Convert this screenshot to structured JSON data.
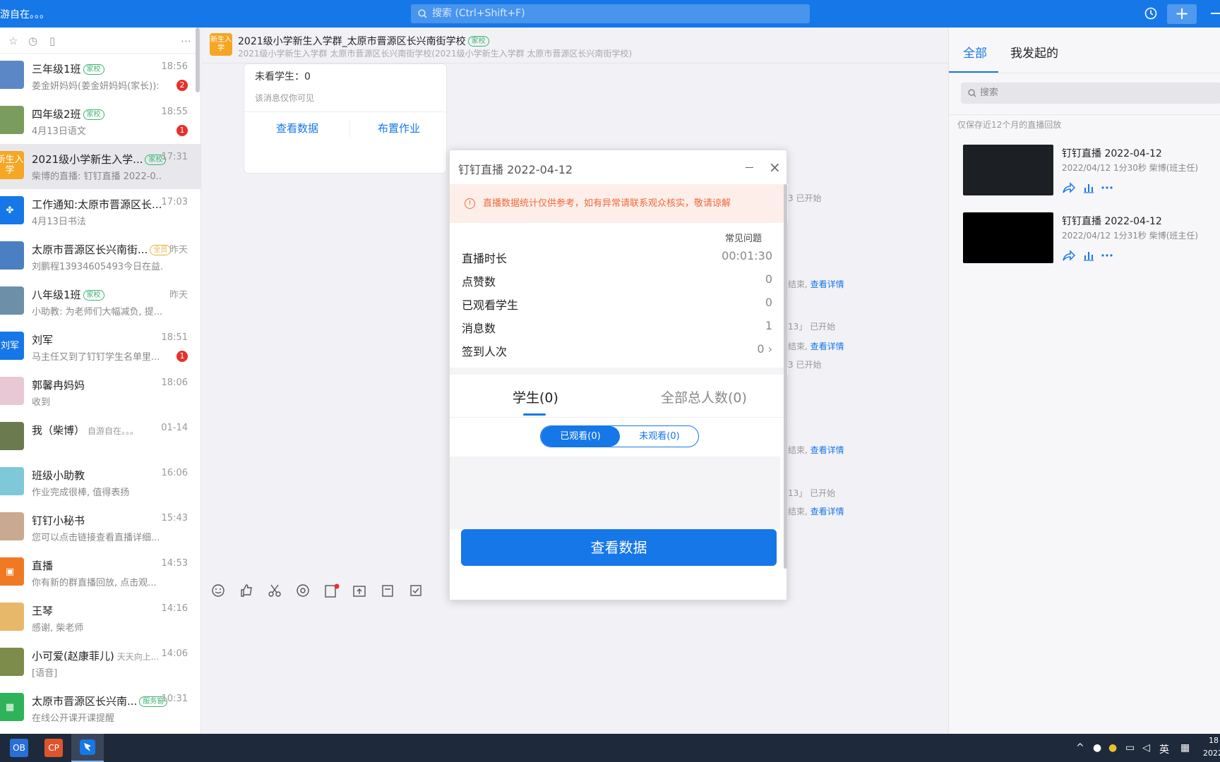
{
  "topbar": {
    "status_text": "游自在。。。",
    "search_placeholder": "搜索 (Ctrl+Shift+F)"
  },
  "conversations": [
    {
      "name": "三年级1班",
      "tag": "家校",
      "time": "18:56",
      "preview": "姜金妍妈妈(姜金妍妈妈(家长)): ...",
      "badge": "2",
      "avatar_color": "#5b87c7",
      "avatar_text": ""
    },
    {
      "name": "四年级2班",
      "tag": "家校",
      "time": "18:55",
      "preview": "4月13日语文",
      "badge": "1",
      "avatar_color": "#7a9c5d",
      "avatar_text": ""
    },
    {
      "name": "2021级小学新生入学...",
      "tag": "家校",
      "time": "17:31",
      "preview": "柴博的直播: 钉钉直播 2022-0...",
      "badge": "",
      "avatar_color": "#f5a623",
      "avatar_text": "新生入学"
    },
    {
      "name": "工作通知:太原市晋源区长...",
      "tag": "",
      "time": "17:03",
      "preview": "4月13日书法",
      "badge": "",
      "avatar_color": "#1677e8",
      "avatar_text": "✤"
    },
    {
      "name": "太原市晋源区长兴南街...",
      "tag": "全员",
      "time": "昨天",
      "preview": "刘鹏程13934605493今日在益...",
      "badge": "",
      "avatar_color": "#4a7fc1",
      "avatar_text": ""
    },
    {
      "name": "八年级1班",
      "tag": "家校",
      "time": "昨天",
      "preview": "小助教: 为老师们大幅减负, 提...",
      "badge": "",
      "avatar_color": "#6d8fa8",
      "avatar_text": ""
    },
    {
      "name": "刘军",
      "tag": "",
      "time": "18:51",
      "preview": "马主任又到了钉钉学生名单里...",
      "badge": "1",
      "avatar_color": "#1677e8",
      "avatar_text": "刘军"
    },
    {
      "name": "郭馨冉妈妈",
      "tag": "",
      "time": "18:06",
      "preview": "收到",
      "badge": "",
      "avatar_color": "#e8c8d4",
      "avatar_text": ""
    },
    {
      "name": "我（柴博）",
      "tag": "",
      "time": "01-14",
      "preview": "",
      "badge": "",
      "avatar_color": "#6b7a4f",
      "avatar_text": "",
      "extra": "自游自在。。。"
    },
    {
      "name": "班级小助教",
      "tag": "",
      "time": "16:06",
      "preview": "作业完成很棒, 值得表扬",
      "badge": "",
      "avatar_color": "#7ec8d8",
      "avatar_text": ""
    },
    {
      "name": "钉钉小秘书",
      "tag": "",
      "time": "15:43",
      "preview": "您可以点击链接查看直播详细...",
      "badge": "",
      "avatar_color": "#c9a98f",
      "avatar_text": ""
    },
    {
      "name": "直播",
      "tag": "",
      "time": "14:53",
      "preview": "你有新的群直播回放, 点击观...",
      "badge": "",
      "avatar_color": "#f07a24",
      "avatar_text": "▣"
    },
    {
      "name": "王琴",
      "tag": "",
      "time": "14:16",
      "preview": "感谢, 柴老师",
      "badge": "",
      "avatar_color": "#e8b86a",
      "avatar_text": ""
    },
    {
      "name": "小可爱(赵康菲儿)",
      "tag": "",
      "time": "14:06",
      "preview": "[语音]",
      "badge": "",
      "avatar_color": "#7d8c4a",
      "avatar_text": "",
      "extra": "天天向上..."
    },
    {
      "name": "太原市晋源区长兴南...",
      "tag": "服务窗",
      "time": "10:31",
      "preview": "在线公开课开课提醒",
      "badge": "",
      "avatar_color": "#2fb35a",
      "avatar_text": "▦"
    }
  ],
  "chat": {
    "group_avatar": "新生入学",
    "title": "2021级小学新生入学群_太原市晋源区长兴南街学校",
    "title_tag": "家校",
    "subtitle": "2021级小学新生入学群  太原市晋源区长兴南街学校(2021级小学新生入学群  太原市晋源区长兴南街学校)",
    "card_unwatched": "未看学生：0",
    "card_note": "该消息仅你可见",
    "card_btn_data": "查看数据",
    "card_btn_homework": "布置作业",
    "sys": [
      {
        "text": "3 已开始",
        "link": ""
      },
      {
        "text": "结束, ",
        "link": "查看详情"
      },
      {
        "text": "13」 已开始",
        "link": ""
      },
      {
        "text": "结束, ",
        "link": "查看详情"
      },
      {
        "text": "3 已开始",
        "link": ""
      },
      {
        "text": "结束, ",
        "link": "查看详情"
      },
      {
        "text": "13」 已开始",
        "link": ""
      },
      {
        "text": "结束, ",
        "link": "查看详情"
      }
    ]
  },
  "modal": {
    "title": "钉钉直播 2022-04-12",
    "warning": "直播数据统计仅供参考，如有异常请联系观众核实，敬请谅解",
    "faq": "常见问题",
    "stats": [
      {
        "label": "直播时长",
        "value": "00:01:30"
      },
      {
        "label": "点赞数",
        "value": "0"
      },
      {
        "label": "已观看学生",
        "value": "0"
      },
      {
        "label": "消息数",
        "value": "1"
      },
      {
        "label": "签到人次",
        "value": "0 ›"
      }
    ],
    "tab_students": "学生(0)",
    "tab_all": "全部总人数(0)",
    "seg_watched": "已观看(0)",
    "seg_unwatched": "未观看(0)",
    "button": "查看数据"
  },
  "right_panel": {
    "tab_all": "全部",
    "tab_mine": "我发起的",
    "search_placeholder": "搜索",
    "note": "仅保存近12个月的直播回放",
    "videos": [
      {
        "title": "钉钉直播 2022-04-12",
        "meta": "2022/04/12 1分30秒 柴博(班主任)"
      },
      {
        "title": "钉钉直播 2022-04-12",
        "meta": "2022/04/12 1分31秒 柴博(班主任)"
      }
    ]
  },
  "taskbar": {
    "app1": "OB",
    "app2": "CP",
    "ime": "英",
    "clock_top": "18",
    "clock_bottom": "2022"
  }
}
